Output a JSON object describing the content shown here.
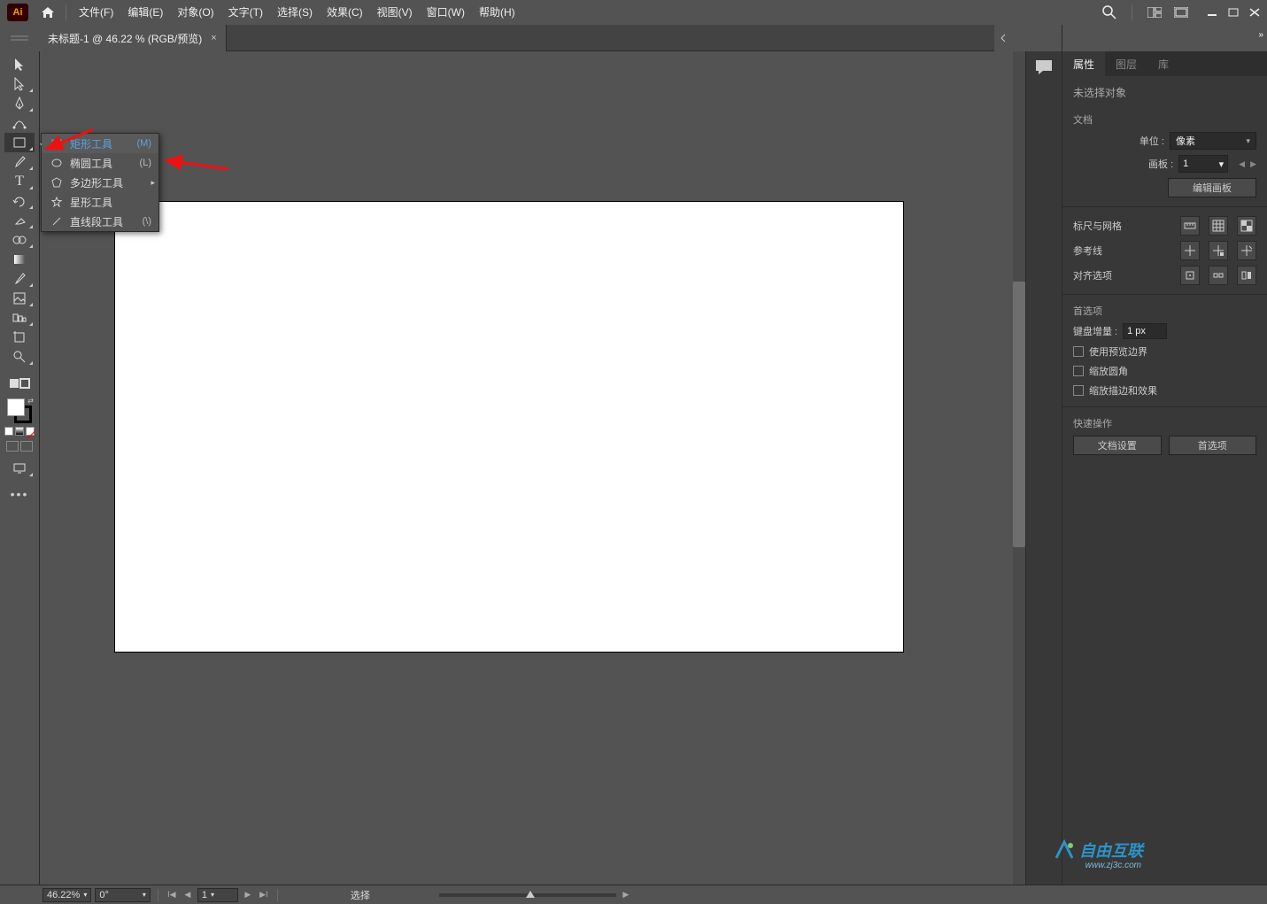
{
  "titlebar": {
    "logo_text": "Ai",
    "menus": [
      "文件(F)",
      "编辑(E)",
      "对象(O)",
      "文字(T)",
      "选择(S)",
      "效果(C)",
      "视图(V)",
      "窗口(W)",
      "帮助(H)"
    ]
  },
  "tab": {
    "title": "未标题-1 @ 46.22 % (RGB/预览)"
  },
  "flyout": {
    "items": [
      {
        "label": "矩形工具",
        "key": "(M)",
        "highlight": true,
        "icon": "rect"
      },
      {
        "label": "椭圆工具",
        "key": "(L)",
        "highlight": false,
        "icon": "ellipse"
      },
      {
        "label": "多边形工具",
        "key": "",
        "highlight": false,
        "icon": "polygon",
        "arrow": true
      },
      {
        "label": "星形工具",
        "key": "",
        "highlight": false,
        "icon": "star"
      },
      {
        "label": "直线段工具",
        "key": "(\\)",
        "highlight": false,
        "icon": "line"
      }
    ]
  },
  "panel": {
    "tabs": {
      "properties": "属性",
      "layers": "图层",
      "libraries": "库"
    },
    "no_selection": "未选择对象",
    "section_document": "文档",
    "units_label": "单位 :",
    "units_value": "像素",
    "artboard_label": "画板 :",
    "artboard_value": "1",
    "edit_artboard_btn": "编辑画板",
    "section_rulers": "标尺与网格",
    "section_guides": "参考线",
    "section_align": "对齐选项",
    "section_prefs": "首选项",
    "key_increment_label": "键盘增量 :",
    "key_increment_value": "1 px",
    "cb_preview": "使用预览边界",
    "cb_scale_corners": "缩放圆角",
    "cb_scale_strokes": "缩放描边和效果",
    "section_quick": "快速操作",
    "btn_doc_setup": "文档设置",
    "btn_prefs": "首选项"
  },
  "statusbar": {
    "zoom": "46.22%",
    "rotation": "0°",
    "artboard_nav": "1",
    "mode": "选择"
  },
  "watermark": {
    "text": "自由互联",
    "sub": "www.zj3c.com"
  }
}
